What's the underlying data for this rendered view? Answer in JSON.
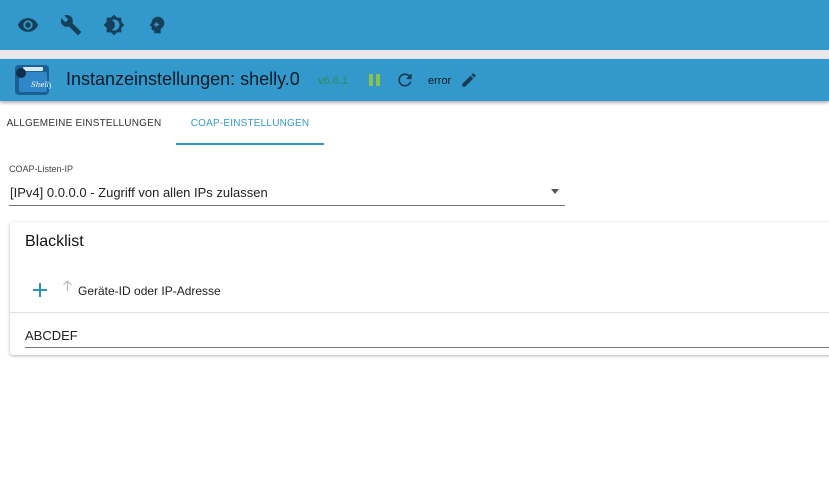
{
  "topbar": {
    "icons": [
      "eye-icon",
      "wrench-icon",
      "brightness-icon",
      "head-icon"
    ]
  },
  "header": {
    "logo_text": "Shelly",
    "title": "Instanzeinstellungen: shelly.0",
    "version": "v6.6.1",
    "status": "error",
    "colors": {
      "bar": "#3399cc",
      "version": "#2e8b57",
      "pause": "#8bc34a"
    }
  },
  "tabs": [
    {
      "label": "ALLGEMEINE EINSTELLUNGEN",
      "active": false
    },
    {
      "label": "COAP-EINSTELLUNGEN",
      "active": true
    }
  ],
  "coap": {
    "listen_ip_label": "COAP-Listen-IP",
    "listen_ip_value": "[IPv4] 0.0.0.0 - Zugriff von allen IPs zulassen"
  },
  "blacklist": {
    "title": "Blacklist",
    "column_header": "Geräte-ID oder IP-Adresse",
    "rows": [
      {
        "value": "ABCDEF"
      }
    ]
  }
}
